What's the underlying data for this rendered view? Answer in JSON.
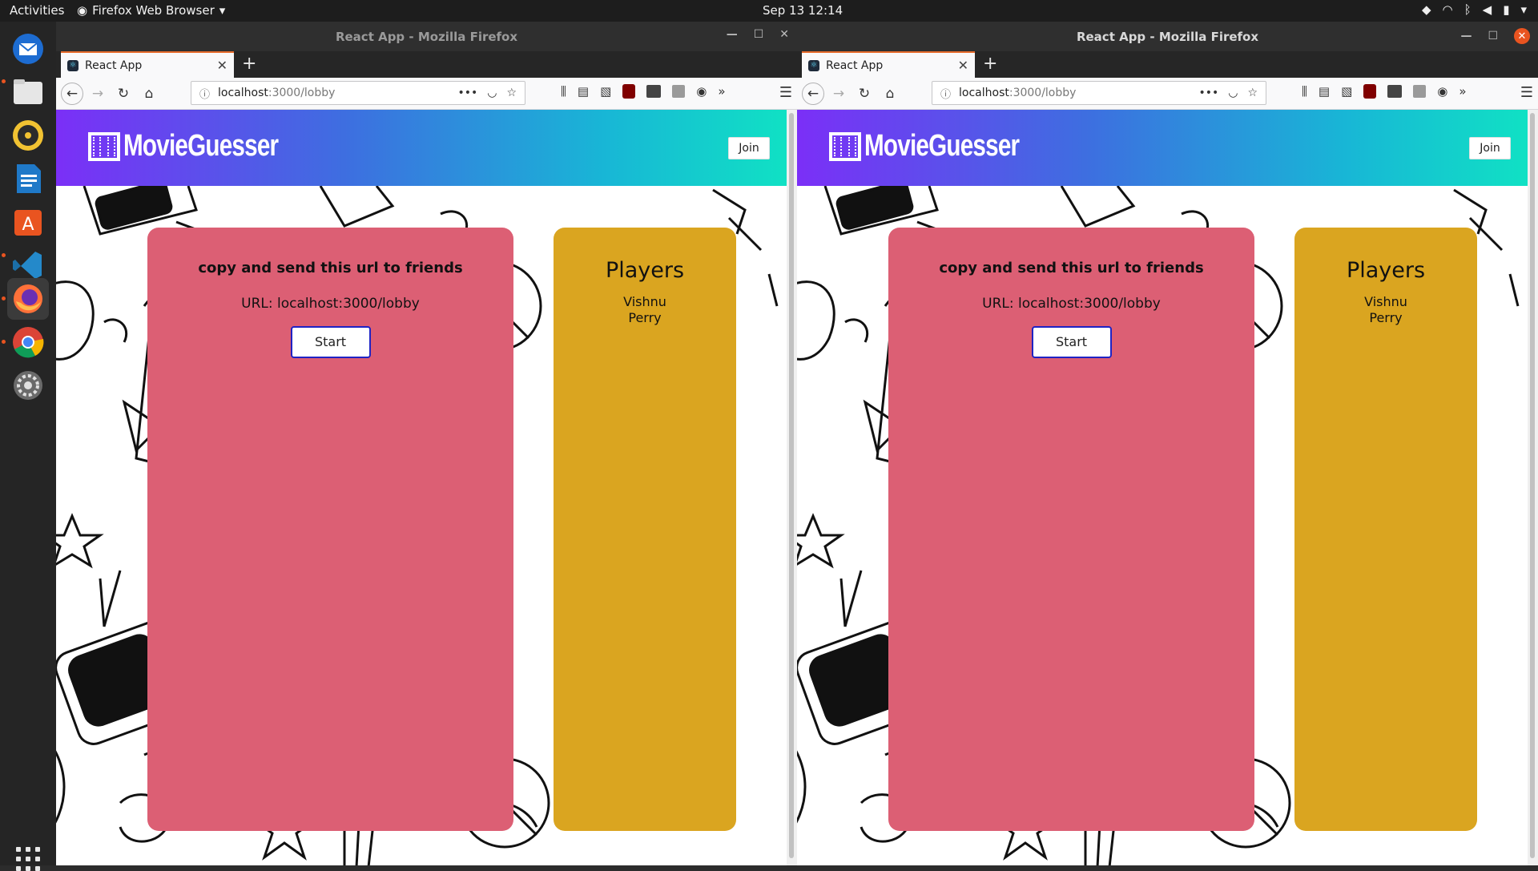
{
  "topbar": {
    "activities": "Activities",
    "app_menu": "Firefox Web Browser",
    "clock": "Sep 13  12:14"
  },
  "dock": {
    "items": [
      "thunderbird-icon",
      "files-icon",
      "rhythmbox-icon",
      "writer-icon",
      "software-center-icon",
      "vscode-icon",
      "firefox-icon",
      "chrome-icon",
      "settings-icon"
    ]
  },
  "windows": [
    {
      "title": "React App - Mozilla Firefox",
      "tab_title": "React App",
      "url_host": "localhost",
      "url_path": ":3000/lobby",
      "app": {
        "logo": "MovieGuesser",
        "join_label": "Join",
        "instruction": "copy and send this url to friends",
        "url_text": "URL: localhost:3000/lobby",
        "start_label": "Start",
        "players_title": "Players",
        "players": [
          "Vishnu",
          "Perry"
        ]
      }
    },
    {
      "title": "React App - Mozilla Firefox",
      "tab_title": "React App",
      "url_host": "localhost",
      "url_path": ":3000/lobby",
      "app": {
        "logo": "MovieGuesser",
        "join_label": "Join",
        "instruction": "copy and send this url to friends",
        "url_text": "URL: localhost:3000/lobby",
        "start_label": "Start",
        "players_title": "Players",
        "players": [
          "Vishnu",
          "Perry"
        ]
      }
    }
  ],
  "colors": {
    "header_start": "#7b2ff7",
    "header_end": "#10e1c4",
    "lobby_card": "#dc5f74",
    "players_card": "#daa520",
    "start_border": "#1f23c4",
    "ubuntu_orange": "#e95420"
  }
}
